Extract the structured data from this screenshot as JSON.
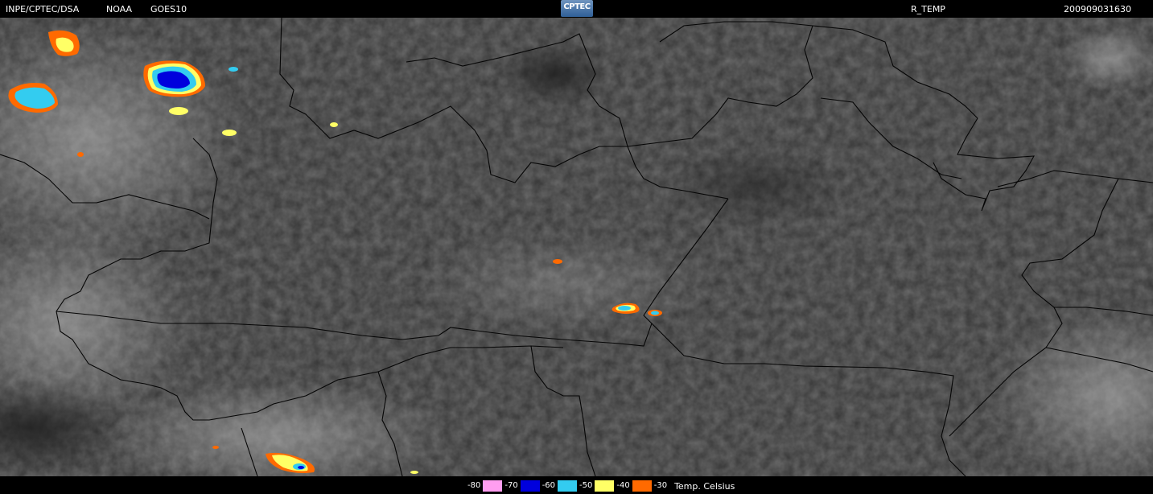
{
  "header": {
    "source": "INPE/CPTEC/DSA",
    "agency": "NOAA",
    "satellite": "GOES10",
    "logo_text": "CPTEC",
    "product": "R_TEMP",
    "timestamp": "200909031630"
  },
  "legend": {
    "unit": "Temp. Celsius",
    "entries": [
      {
        "label": "-80",
        "color": "#ff9ef0"
      },
      {
        "label": "-70",
        "color": "#0000dd"
      },
      {
        "label": "-60",
        "color": "#33ccf0"
      },
      {
        "label": "-50",
        "color": "#ffff66"
      },
      {
        "label": "-40",
        "color": "#ff6a00"
      },
      {
        "label": "-30",
        "color": ""
      }
    ]
  },
  "colors": {
    "background": "#000000",
    "cloud_gray": "#3a3a3a",
    "border_line": "#000000"
  }
}
